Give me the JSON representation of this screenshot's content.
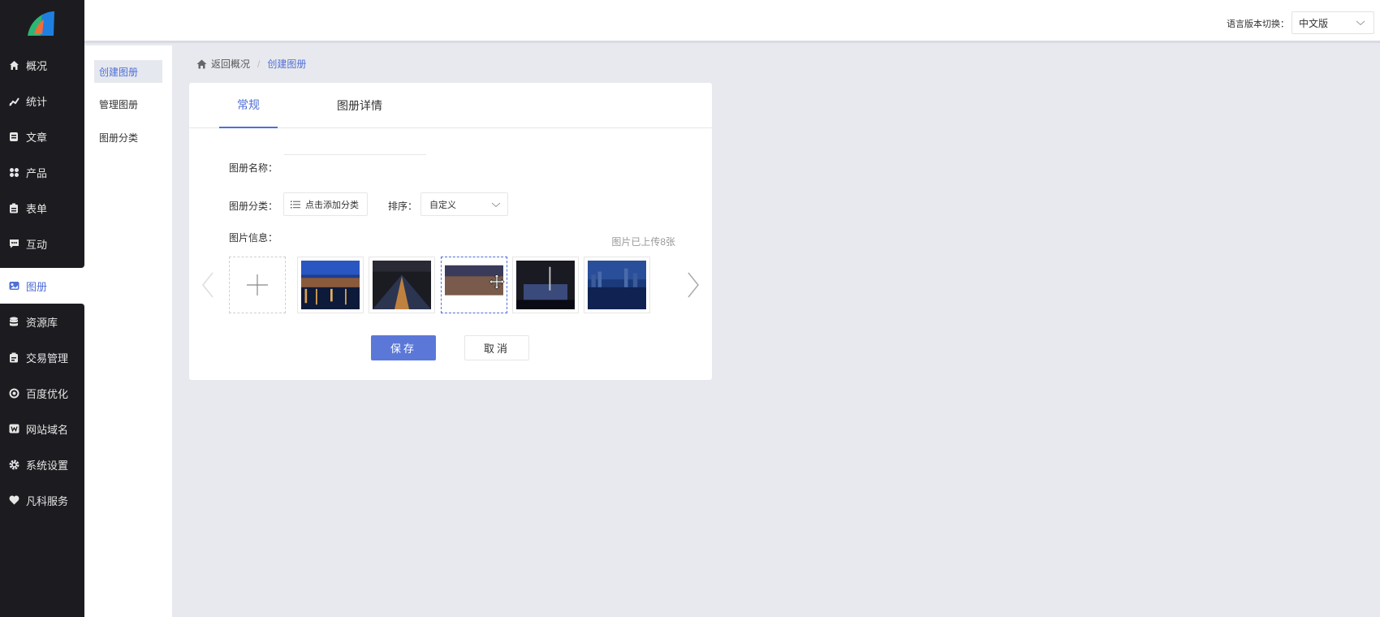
{
  "sidebar": {
    "items": [
      {
        "label": "概况",
        "icon": "home-icon"
      },
      {
        "label": "统计",
        "icon": "chart-icon"
      },
      {
        "label": "文章",
        "icon": "document-icon"
      },
      {
        "label": "产品",
        "icon": "grid-icon"
      },
      {
        "label": "表单",
        "icon": "clipboard-icon"
      },
      {
        "label": "互动",
        "icon": "chat-icon"
      },
      {
        "label": "图册",
        "icon": "album-icon"
      },
      {
        "label": "资源库",
        "icon": "database-icon"
      },
      {
        "label": "交易管理",
        "icon": "trade-icon"
      },
      {
        "label": "百度优化",
        "icon": "seo-icon"
      },
      {
        "label": "网站域名",
        "icon": "domain-icon"
      },
      {
        "label": "系统设置",
        "icon": "gear-icon"
      },
      {
        "label": "凡科服务",
        "icon": "heart-icon"
      }
    ],
    "active_label": "图册"
  },
  "header": {
    "lang_label": "语言版本切换：",
    "lang_value": "中文版"
  },
  "subnav": {
    "items": [
      "创建图册",
      "管理图册",
      "图册分类"
    ],
    "active": "创建图册"
  },
  "breadcrumb": {
    "home": "返回概况",
    "separator": "/",
    "current": "创建图册"
  },
  "tabs": [
    "常规",
    "图册详情"
  ],
  "form": {
    "name_label": "图册名称：",
    "name_value": "",
    "category_label": "图册分类：",
    "category_button": "点击添加分类",
    "sort_label": "排序：",
    "sort_value": "自定义",
    "images_label": "图片信息：",
    "uploaded_text": "图片已上传8张"
  },
  "actions": {
    "save": "保存",
    "cancel": "取消"
  },
  "colors": {
    "accent": "#4f6fd6",
    "sidebar_bg": "#1c1c20",
    "page_bg": "#e8e9ee"
  }
}
